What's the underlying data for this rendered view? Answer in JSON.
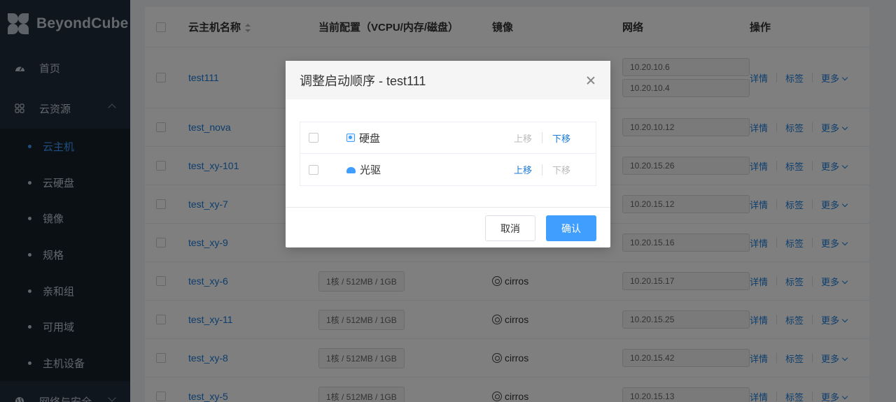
{
  "app": {
    "brand": "BeyondCube"
  },
  "sidebar": {
    "items": [
      {
        "label": "首页",
        "icon": "dashboard-icon"
      },
      {
        "label": "云资源",
        "icon": "grid-icon"
      }
    ],
    "submenu": [
      {
        "label": "云主机",
        "active": true
      },
      {
        "label": "云硬盘"
      },
      {
        "label": "镜像"
      },
      {
        "label": "规格"
      },
      {
        "label": "亲和组"
      },
      {
        "label": "可用域"
      },
      {
        "label": "主机设备"
      }
    ],
    "next_group": {
      "label": "网络与安全",
      "icon": "globe-icon"
    }
  },
  "table": {
    "headers": {
      "name": "云主机名称",
      "config": "当前配置（VCPU/内存/磁盘）",
      "image": "镜像",
      "network": "网络",
      "ops": "操作"
    },
    "ops": {
      "details": "详情",
      "tags": "标签",
      "more": "更多"
    },
    "rows": [
      {
        "name": "test111",
        "config": "",
        "image": "",
        "networks": [
          "10.20.10.6",
          "10.20.10.4"
        ]
      },
      {
        "name": "test_nova",
        "config": "",
        "image": "",
        "networks": [
          "10.20.10.12"
        ]
      },
      {
        "name": "test_xy-101",
        "config": "",
        "image": "",
        "networks": [
          "10.20.15.26"
        ]
      },
      {
        "name": "test_xy-7",
        "config": "",
        "image": "",
        "networks": [
          "10.20.15.12"
        ]
      },
      {
        "name": "test_xy-9",
        "config": "",
        "image": "",
        "networks": [
          "10.20.15.16"
        ]
      },
      {
        "name": "test_xy-6",
        "config": "1核 / 512MB / 1GB",
        "image": "cirros",
        "networks": [
          "10.20.15.17"
        ]
      },
      {
        "name": "test_xy-11",
        "config": "1核 / 512MB / 1GB",
        "image": "cirros",
        "networks": [
          "10.20.15.25"
        ]
      },
      {
        "name": "test_xy-8",
        "config": "1核 / 512MB / 1GB",
        "image": "cirros",
        "networks": [
          "10.20.15.42"
        ]
      },
      {
        "name": "test_xy-5",
        "config": "1核 / 512MB / 1GB",
        "image": "cirros",
        "networks": [
          "10.20.15.13"
        ]
      }
    ]
  },
  "modal": {
    "title": "调整启动顺序 - test111",
    "items": [
      {
        "label": "硬盘",
        "icon": "disk-icon",
        "up": "上移",
        "down": "下移",
        "up_enabled": false,
        "down_enabled": true
      },
      {
        "label": "光驱",
        "icon": "cdrom-icon",
        "up": "上移",
        "down": "下移",
        "up_enabled": true,
        "down_enabled": false
      }
    ],
    "cancel": "取消",
    "confirm": "确认"
  },
  "colors": {
    "primary": "#409eff",
    "sidebar_bg": "#1f2d3d",
    "link": "#1a7bd9"
  }
}
